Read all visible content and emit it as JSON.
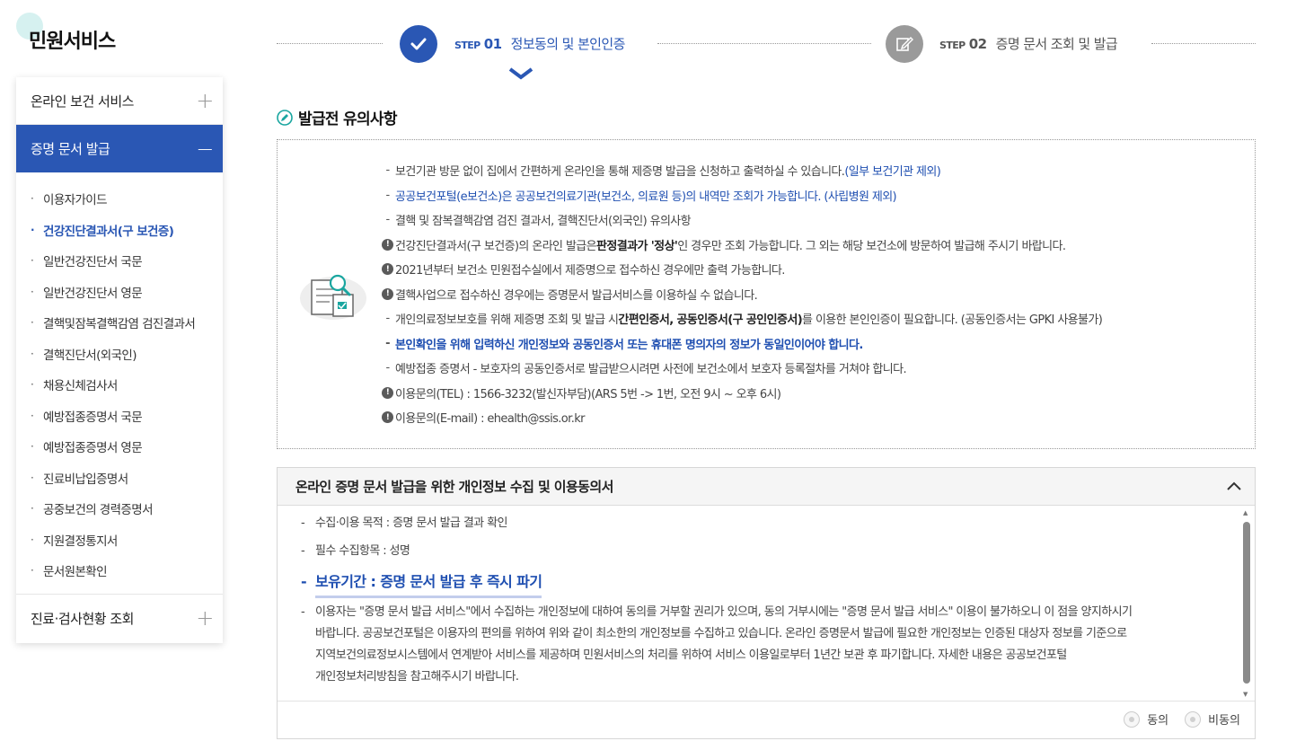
{
  "sidebar": {
    "title": "민원서비스",
    "menus": [
      {
        "label": "온라인 보건 서비스",
        "toggle": "+"
      },
      {
        "label": "증명 문서 발급",
        "toggle": "−"
      },
      {
        "label": "진료·검사현황 조회",
        "toggle": "+"
      }
    ],
    "sub_items": [
      "이용자가이드",
      "건강진단결과서(구 보건증)",
      "일반건강진단서 국문",
      "일반건강진단서 영문",
      "결핵및잠복결핵감염 검진결과서",
      "결핵진단서(외국인)",
      "채용신체검사서",
      "예방접종증명서 국문",
      "예방접종증명서 영문",
      "진료비납입증명서",
      "공중보건의 경력증명서",
      "지원결정통지서",
      "문서원본확인"
    ]
  },
  "steps": [
    {
      "step_word": "STEP",
      "num": "01",
      "label": "정보동의 및 본인인증"
    },
    {
      "step_word": "STEP",
      "num": "02",
      "label": "증명 문서 조회 및 발급"
    }
  ],
  "notice": {
    "title": "발급전 유의사항",
    "items": {
      "i1a": "보건기관 방문 없이 집에서 간편하게 온라인을 통해 제증명 발급을 신청하고 출력하실 수 있습니다.",
      "i1b": "(일부 보건기관 제외)",
      "i2": "공공보건포털(e보건소)은 공공보건의료기관(보건소, 의료원 등)의 내역만 조회가 가능합니다. (사립병원 제외)",
      "i3": "결핵 및 잠복결핵감염 검진 결과서, 결핵진단서(외국인) 유의사항",
      "i4a": "건강진단결과서(구 보건증)의 온라인 발급은 ",
      "i4b": "판정결과가 '정상'",
      "i4c": "인 경우만 조회 가능합니다. 그 외는 해당 보건소에 방문하여 발급해 주시기 바랍니다.",
      "i5": "2021년부터 보건소 민원접수실에서 제증명으로 접수하신 경우에만 출력 가능합니다.",
      "i6": "결핵사업으로 접수하신 경우에는 증명문서 발급서비스를 이용하실 수 없습니다.",
      "i7a": "개인의료정보보호를 위해 제증명 조회 및 발급 시 ",
      "i7b": "간편인증서, 공동인증서(구 공인인증서)",
      "i7c": "를 이용한 본인인증이 필요합니다. (공동인증서는 GPKI 사용불가)",
      "i8": "본인확인을 위해 입력하신 개인정보와 공동인증서 또는 휴대폰 명의자의 정보가 동일인이어야 합니다.",
      "i9": "예방접종 증명서 - 보호자의 공동인증서로 발급받으시려면 사전에 보건소에서 보호자 등록절차를 거쳐야 합니다.",
      "i10": "이용문의(TEL) : 1566-3232(발신자부담)(ARS 5번 -> 1번, 오전 9시 ~ 오후 6시)",
      "i11": "이용문의(E-mail) : ehealth@ssis.or.kr"
    }
  },
  "consent": {
    "title": "온라인 증명 문서 발급을 위한 개인정보 수집 및 이용동의서",
    "purpose": "수집·이용 목적 : 증명 문서 발급 결과 확인",
    "fields": "필수 수집항목 : 성명",
    "retention": "보유기간 : 증명 문서 발급 후 즉시 파기",
    "rights_l1": "이용자는 \"증명 문서 발급 서비스\"에서 수집하는 개인정보에 대하여 동의를 거부할 권리가 있으며, 동의 거부시에는 \"증명 문서 발급 서비스\" 이용이 불가하오니 이 점을 양지하시기",
    "rights_l2": "바랍니다. 공공보건포털은 이용자의 편의를 위하여 위와 같이 최소한의 개인정보를 수집하고 있습니다. 온라인 증명문서 발급에 필요한 개인정보는 인증된 대상자 정보를 기준으로",
    "rights_l3": "지역보건의료정보시스템에서 연계받아 서비스를 제공하며 민원서비스의 처리를 위하여 서비스 이용일로부터 1년간 보관 후 파기합니다. 자세한 내용은 공공보건포털",
    "rights_l4": "개인정보처리방침을 참고해주시기 바랍니다.",
    "agree": "동의",
    "disagree": "비동의"
  },
  "colors": {
    "brand_blue": "#2a57b4",
    "link_blue": "#1f4fb1",
    "inactive_gray": "#9a9a9a"
  }
}
